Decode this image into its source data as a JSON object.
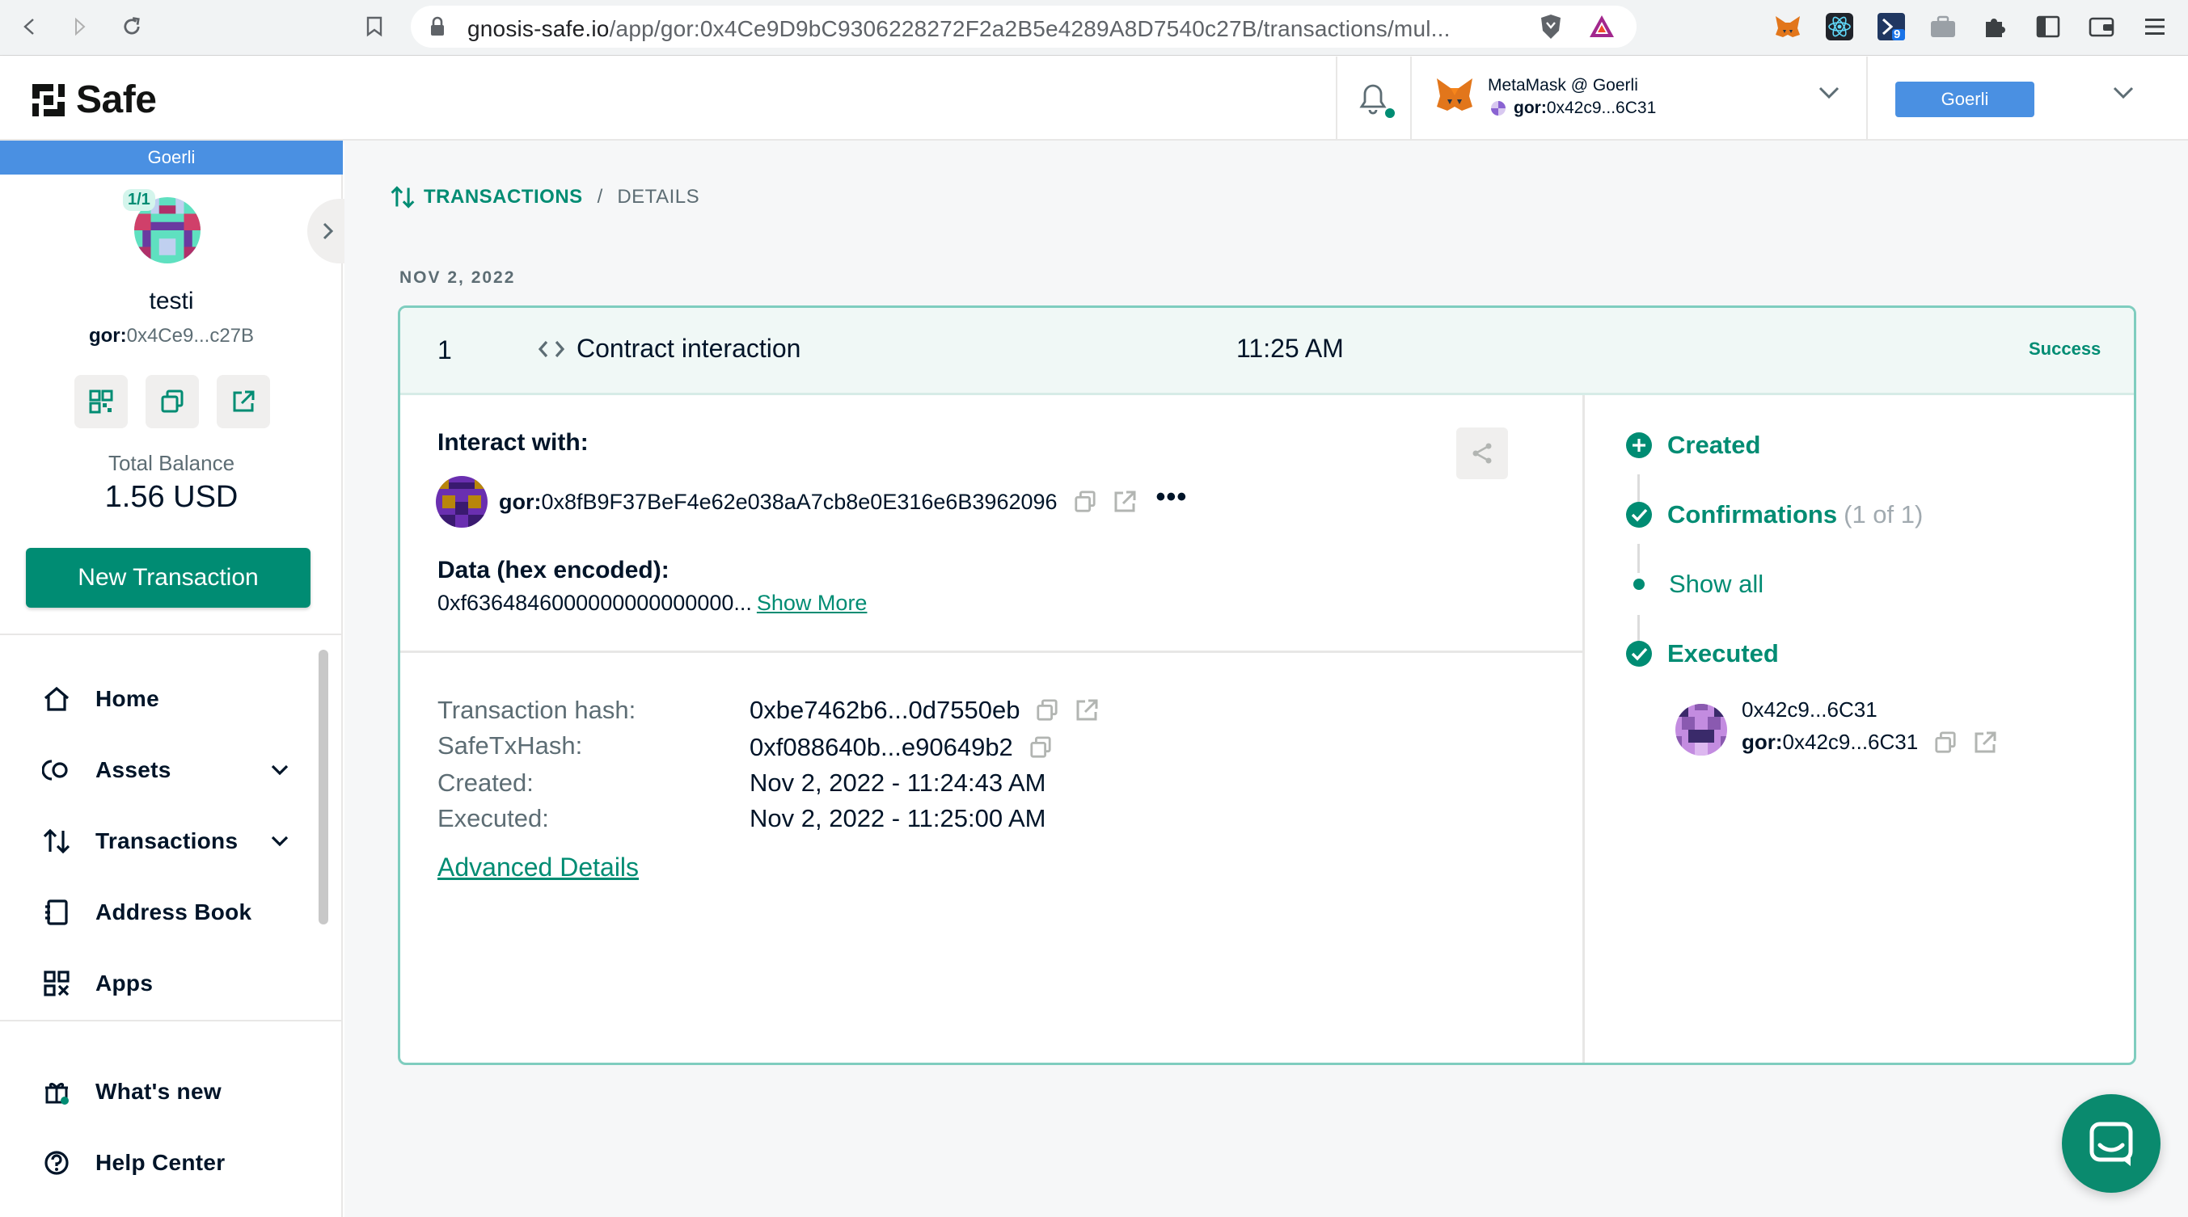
{
  "browser": {
    "url_host": "gnosis-safe.io",
    "url_path": "/app/gor:0x4Ce9D9bC9306228272F2a2B5e4289A8D7540c27B/transactions/mul...",
    "extension_badge": "9"
  },
  "header": {
    "logo": "Safe",
    "wallet_name": "MetaMask @ Goerli",
    "wallet_prefix": "gor:",
    "wallet_address": "0x42c9...6C31",
    "network_button": "Goerli"
  },
  "sidebar": {
    "network": "Goerli",
    "threshold": "1/1",
    "safe_name": "testi",
    "safe_prefix": "gor:",
    "safe_address": "0x4Ce9...c27B",
    "total_balance_label": "Total Balance",
    "total_balance_value": "1.56 USD",
    "new_transaction": "New Transaction",
    "nav": [
      {
        "label": "Home",
        "icon": "home-icon"
      },
      {
        "label": "Assets",
        "icon": "assets-icon"
      },
      {
        "label": "Transactions",
        "icon": "transactions-icon"
      },
      {
        "label": "Address Book",
        "icon": "address-book-icon"
      },
      {
        "label": "Apps",
        "icon": "apps-icon"
      },
      {
        "label": "What's new",
        "icon": "gift-icon"
      },
      {
        "label": "Help Center",
        "icon": "help-icon"
      }
    ]
  },
  "breadcrumb": {
    "section": "TRANSACTIONS",
    "separator": "/",
    "page": "DETAILS"
  },
  "date_label": "NOV 2, 2022",
  "transaction": {
    "nonce": "1",
    "type": "Contract interaction",
    "time": "11:25 AM",
    "status": "Success",
    "interact_with_label": "Interact with:",
    "interact_prefix": "gor:",
    "interact_address": "0x8fB9F37BeF4e62e038aA7cb8e0E316e6B3962096",
    "more_label": "•••",
    "data_label": "Data (hex encoded):",
    "data_value": "0xf6364846000000000000000...",
    "show_more": "Show More",
    "fields": [
      {
        "label": "Transaction hash:",
        "value": "0xbe7462b6...0d7550eb"
      },
      {
        "label": "SafeTxHash:",
        "value": "0xf088640b...e90649b2"
      },
      {
        "label": "Created:",
        "value": "Nov 2, 2022 - 11:24:43 AM"
      },
      {
        "label": "Executed:",
        "value": "Nov 2, 2022 - 11:25:00 AM"
      }
    ],
    "advanced_details": "Advanced Details"
  },
  "timeline": {
    "created": "Created",
    "confirmations": "Confirmations",
    "confirmations_count": "(1 of 1)",
    "show_all": "Show all",
    "executed": "Executed",
    "executor_name": "0x42c9...6C31",
    "executor_prefix": "gor:",
    "executor_address": "0x42c9...6C31"
  },
  "colors": {
    "primary": "#008c73",
    "network": "#4a90e2",
    "card_border": "#7fcdbf"
  }
}
